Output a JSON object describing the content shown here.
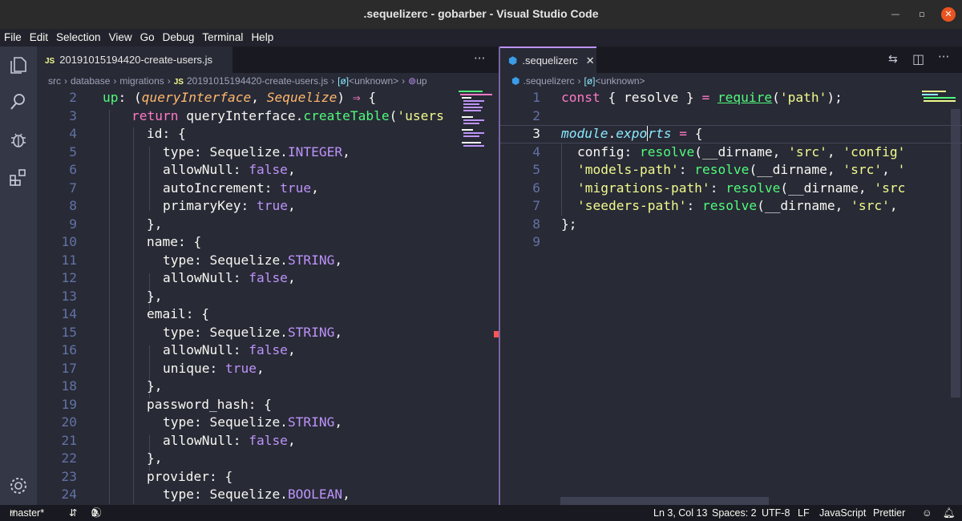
{
  "window": {
    "title": ".sequelizerc - gobarber - Visual Studio Code"
  },
  "menu": [
    "File",
    "Edit",
    "Selection",
    "View",
    "Go",
    "Debug",
    "Terminal",
    "Help"
  ],
  "left_editor": {
    "tab_label": "20191015194420-create-users.js",
    "tab_badge": "JS",
    "breadcrumb": [
      "src",
      "database",
      "migrations",
      "20191015194420-create-users.js",
      "<unknown>",
      "up"
    ],
    "line_numbers": [
      "2",
      "3",
      "4",
      "5",
      "6",
      "7",
      "8",
      "9",
      "10",
      "11",
      "12",
      "13",
      "14",
      "15",
      "16",
      "17",
      "18",
      "19",
      "20",
      "21",
      "22",
      "23",
      "24"
    ]
  },
  "right_editor": {
    "tab_label": ".sequelizerc",
    "breadcrumb": [
      ".sequelizerc",
      "<unknown>"
    ],
    "line_numbers": [
      "1",
      "2",
      "3",
      "4",
      "5",
      "6",
      "7",
      "8",
      "9"
    ]
  },
  "status": {
    "branch": "master*",
    "errors": "1",
    "warnings": "0",
    "position": "Ln 3, Col 13",
    "spaces": "Spaces: 2",
    "encoding": "UTF-8",
    "eol": "LF",
    "language": "JavaScript",
    "formatter": "Prettier"
  },
  "colors": {
    "keyword": "#ff79c6",
    "function": "#50fa7b",
    "param": "#ffb86c",
    "constant": "#bd93f9",
    "string": "#f1fa8c",
    "background": "#282a36"
  }
}
